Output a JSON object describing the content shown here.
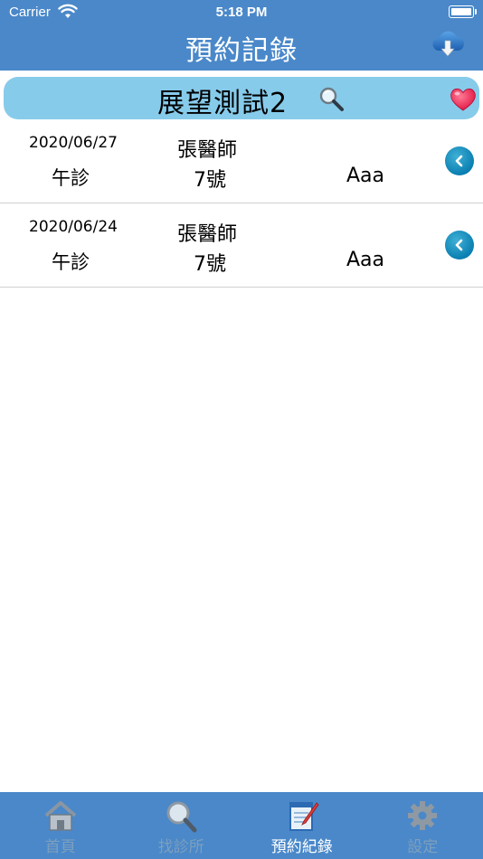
{
  "status_bar": {
    "carrier": "Carrier",
    "time": "5:18 PM"
  },
  "header": {
    "title": "預約記錄",
    "cloud_icon": "cloud-download-icon"
  },
  "clinic": {
    "name": "展望測試2",
    "search_icon": "search-icon",
    "favorite_icon": "heart-icon"
  },
  "records": [
    {
      "date": "2020/06/27",
      "doctor": "張醫師",
      "session": "午診",
      "number": "7號",
      "patient": "Aaa"
    },
    {
      "date": "2020/06/24",
      "doctor": "張醫師",
      "session": "午診",
      "number": "7號",
      "patient": "Aaa"
    }
  ],
  "tabs": [
    {
      "label": "首頁",
      "icon": "home-icon",
      "active": false
    },
    {
      "label": "找診所",
      "icon": "magnifier-icon",
      "active": false
    },
    {
      "label": "預約紀錄",
      "icon": "notepad-icon",
      "active": true
    },
    {
      "label": "設定",
      "icon": "gear-icon",
      "active": false
    }
  ],
  "colors": {
    "header": "#4a88c9",
    "banner": "#87cbeb",
    "chevron": "#0a7fb1"
  }
}
